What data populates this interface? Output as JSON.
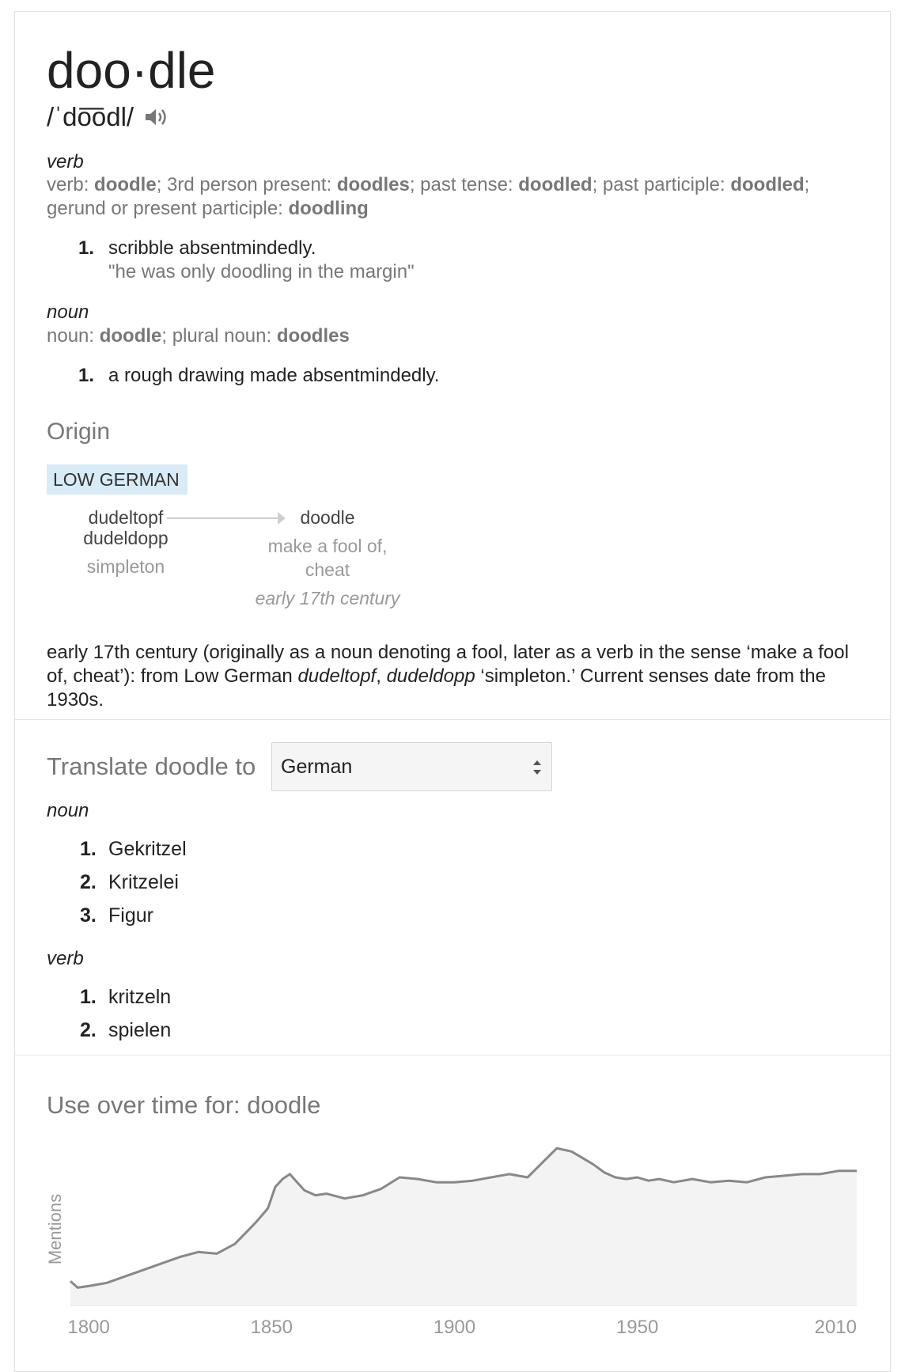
{
  "entry": {
    "headword": "doo·dle",
    "pronunciation": "/ˈdo͞odl/",
    "speaker_icon": "speaker-icon"
  },
  "verb_block": {
    "pos": "verb",
    "forms": [
      {
        "label": "verb: ",
        "form": "doodle"
      },
      {
        "label": "; 3rd person present: ",
        "form": "doodles"
      },
      {
        "label": "; past tense: ",
        "form": "doodled"
      },
      {
        "label": "; past participle: ",
        "form": "doodled"
      },
      {
        "label": "; gerund or present participle: ",
        "form": "doodling"
      }
    ],
    "senses": [
      {
        "num": "1.",
        "definition": "scribble absentmindedly.",
        "example": "\"he was only doodling in the margin\""
      }
    ]
  },
  "noun_block": {
    "pos": "noun",
    "forms": [
      {
        "label": "noun: ",
        "form": "doodle"
      },
      {
        "label": "; plural noun: ",
        "form": "doodles"
      }
    ],
    "senses": [
      {
        "num": "1.",
        "definition": "a rough drawing made absentmindedly."
      }
    ]
  },
  "origin": {
    "heading": "Origin",
    "language": "LOW GERMAN",
    "source_word_1": "dudeltopf",
    "source_word_2": "dudeldopp",
    "source_gloss": "simpleton",
    "target_word": "doodle",
    "target_gloss_1": "make a fool of,",
    "target_gloss_2": "cheat",
    "target_date": "early 17th century",
    "text_1": "early 17th century (originally as a noun denoting a fool, later as a verb in the sense ‘make a fool of, cheat’): from Low German ",
    "text_word_1": "dudeltopf",
    "text_2": ", ",
    "text_word_2": "dudeldopp",
    "text_3": " ‘simpleton.’ Current senses date from the 1930s."
  },
  "translate": {
    "label": "Translate doodle to",
    "selected_language": "German",
    "noun_label": "noun",
    "noun_items": [
      {
        "num": "1.",
        "text": "Gekritzel"
      },
      {
        "num": "2.",
        "text": "Kritzelei"
      },
      {
        "num": "3.",
        "text": "Figur"
      }
    ],
    "verb_label": "verb",
    "verb_items": [
      {
        "num": "1.",
        "text": "kritzeln"
      },
      {
        "num": "2.",
        "text": "spielen"
      }
    ]
  },
  "usage": {
    "title": "Use over time for: doodle"
  },
  "chart_data": {
    "type": "area",
    "ylabel": "Mentions",
    "xlabel": "",
    "x_ticks": [
      "1800",
      "1850",
      "1900",
      "1950",
      "2010"
    ],
    "xlim": [
      1795,
      2010
    ],
    "ylim": [
      0,
      100
    ],
    "grid": false,
    "line_color": "#888888",
    "fill_color": "#f3f3f3",
    "series": [
      {
        "x": [
          1795,
          1797,
          1800,
          1805,
          1810,
          1815,
          1820,
          1825,
          1830,
          1835,
          1840,
          1843,
          1846,
          1849,
          1851,
          1853,
          1855,
          1857,
          1859,
          1862,
          1865,
          1870,
          1875,
          1880,
          1885,
          1890,
          1895,
          1900,
          1905,
          1910,
          1915,
          1920,
          1924,
          1928,
          1932,
          1935,
          1938,
          1941,
          1944,
          1947,
          1950,
          1953,
          1956,
          1960,
          1965,
          1970,
          1975,
          1980,
          1985,
          1990,
          1995,
          2000,
          2005,
          2010
        ],
        "values": [
          15,
          11,
          12,
          14,
          18,
          22,
          26,
          30,
          33,
          32,
          38,
          45,
          52,
          60,
          73,
          78,
          81,
          76,
          71,
          68,
          69,
          66,
          68,
          72,
          79,
          78,
          76,
          76,
          77,
          79,
          81,
          79,
          88,
          97,
          95,
          91,
          87,
          82,
          79,
          78,
          79,
          77,
          78,
          76,
          78,
          76,
          77,
          76,
          79,
          80,
          81,
          81,
          83,
          83
        ]
      }
    ]
  }
}
